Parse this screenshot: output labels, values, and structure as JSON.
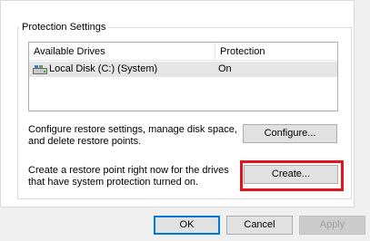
{
  "protection_settings": {
    "group_label": "Protection Settings",
    "table": {
      "columns": [
        "Available Drives",
        "Protection"
      ],
      "rows": [
        {
          "drive": "Local Disk (C:) (System)",
          "protection": "On",
          "icon": "drive-icon"
        }
      ]
    },
    "configure": {
      "description": "Configure restore settings, manage disk space, and delete restore points.",
      "button_label": "Configure..."
    },
    "create": {
      "description": "Create a restore point right now for the drives that have system protection turned on.",
      "button_label": "Create..."
    }
  },
  "dialog_buttons": {
    "ok": "OK",
    "cancel": "Cancel",
    "apply": "Apply"
  },
  "highlight_color": "#e3141e"
}
